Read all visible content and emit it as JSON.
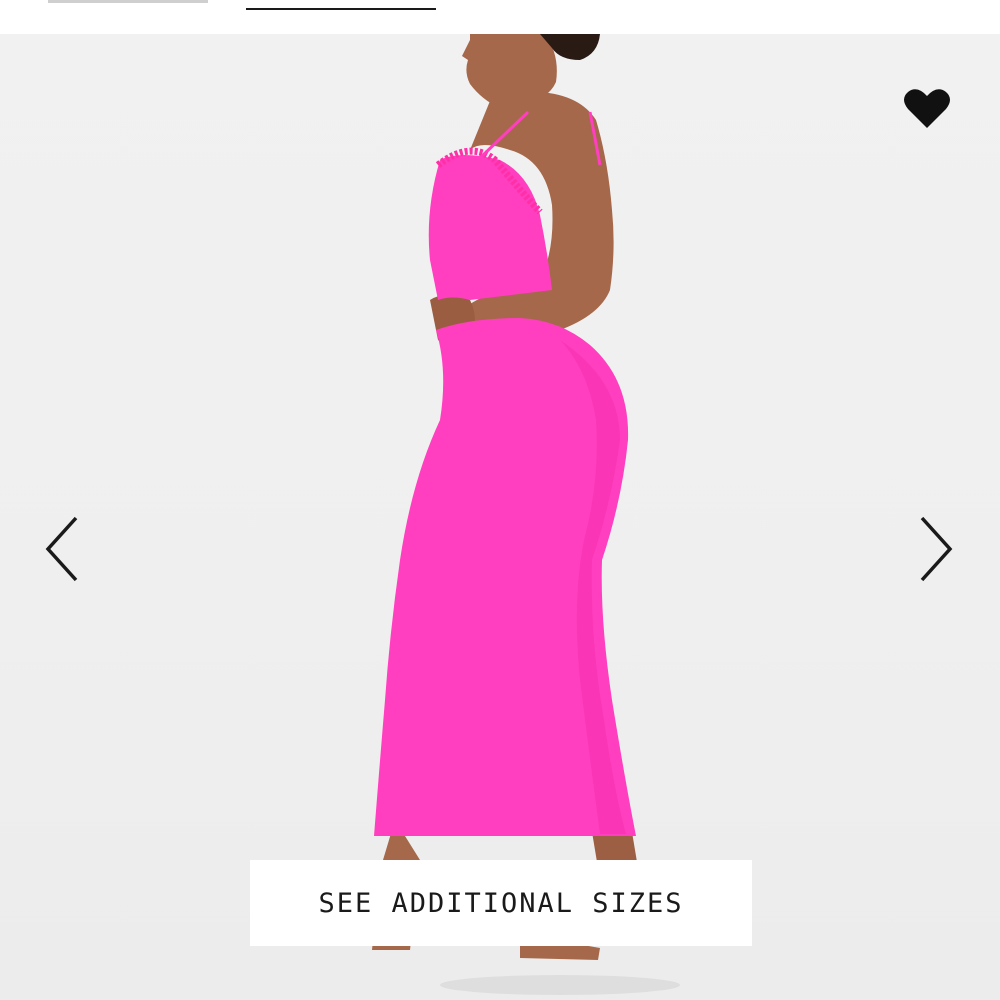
{
  "colors": {
    "background": "#efefef",
    "dress": "#ff3fbf",
    "skin": "#a5684a",
    "icon": "#111111",
    "button_bg": "#ffffff"
  },
  "header": {
    "tabs": [
      {
        "name": "previous-tab",
        "active": false
      },
      {
        "name": "active-tab",
        "active": true
      }
    ]
  },
  "gallery": {
    "favorite_icon": "heart-icon",
    "favorite_state": "filled",
    "prev_icon": "chevron-left-icon",
    "next_icon": "chevron-right-icon"
  },
  "actions": {
    "sizes_label": "SEE ADDITIONAL SIZES"
  }
}
